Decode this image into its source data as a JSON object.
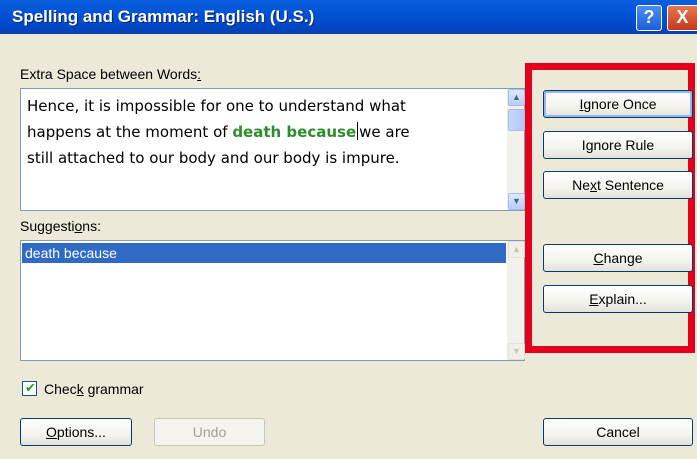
{
  "window": {
    "title": "Spelling and Grammar: English (U.S.)",
    "help_glyph": "?",
    "close_glyph": "X"
  },
  "error_label": {
    "text": "Extra Space between Words",
    "suffix": ":"
  },
  "sentence": {
    "line1": "Hence, it is impossible for one to understand what",
    "line2_before": "happens at the moment of ",
    "line2_error": "death  because",
    "line2_after": "we are",
    "line3": "still attached to our body and our body is impure."
  },
  "suggestions": {
    "label_before": "Suggesti",
    "label_access": "o",
    "label_after": "ns:",
    "items": [
      "death because"
    ]
  },
  "buttons": {
    "ignore_once": {
      "access": "I",
      "rest": "gnore Once"
    },
    "ignore_rule": {
      "before": "I",
      "access": "g",
      "after": "nore Rule"
    },
    "next_sentence": {
      "before": "Ne",
      "access": "x",
      "after": "t Sentence"
    },
    "change": {
      "access": "C",
      "rest": "hange"
    },
    "explain": {
      "access": "E",
      "rest": "xplain..."
    },
    "options": {
      "access": "O",
      "rest": "ptions..."
    },
    "undo": "Undo",
    "cancel": "Cancel"
  },
  "check_grammar": {
    "checked": true,
    "label_before": "Chec",
    "label_access": "k",
    "label_after": " grammar"
  },
  "colors": {
    "error_text": "#2e8b2e",
    "highlight_box": "#e4001b",
    "selection": "#316ac5"
  }
}
